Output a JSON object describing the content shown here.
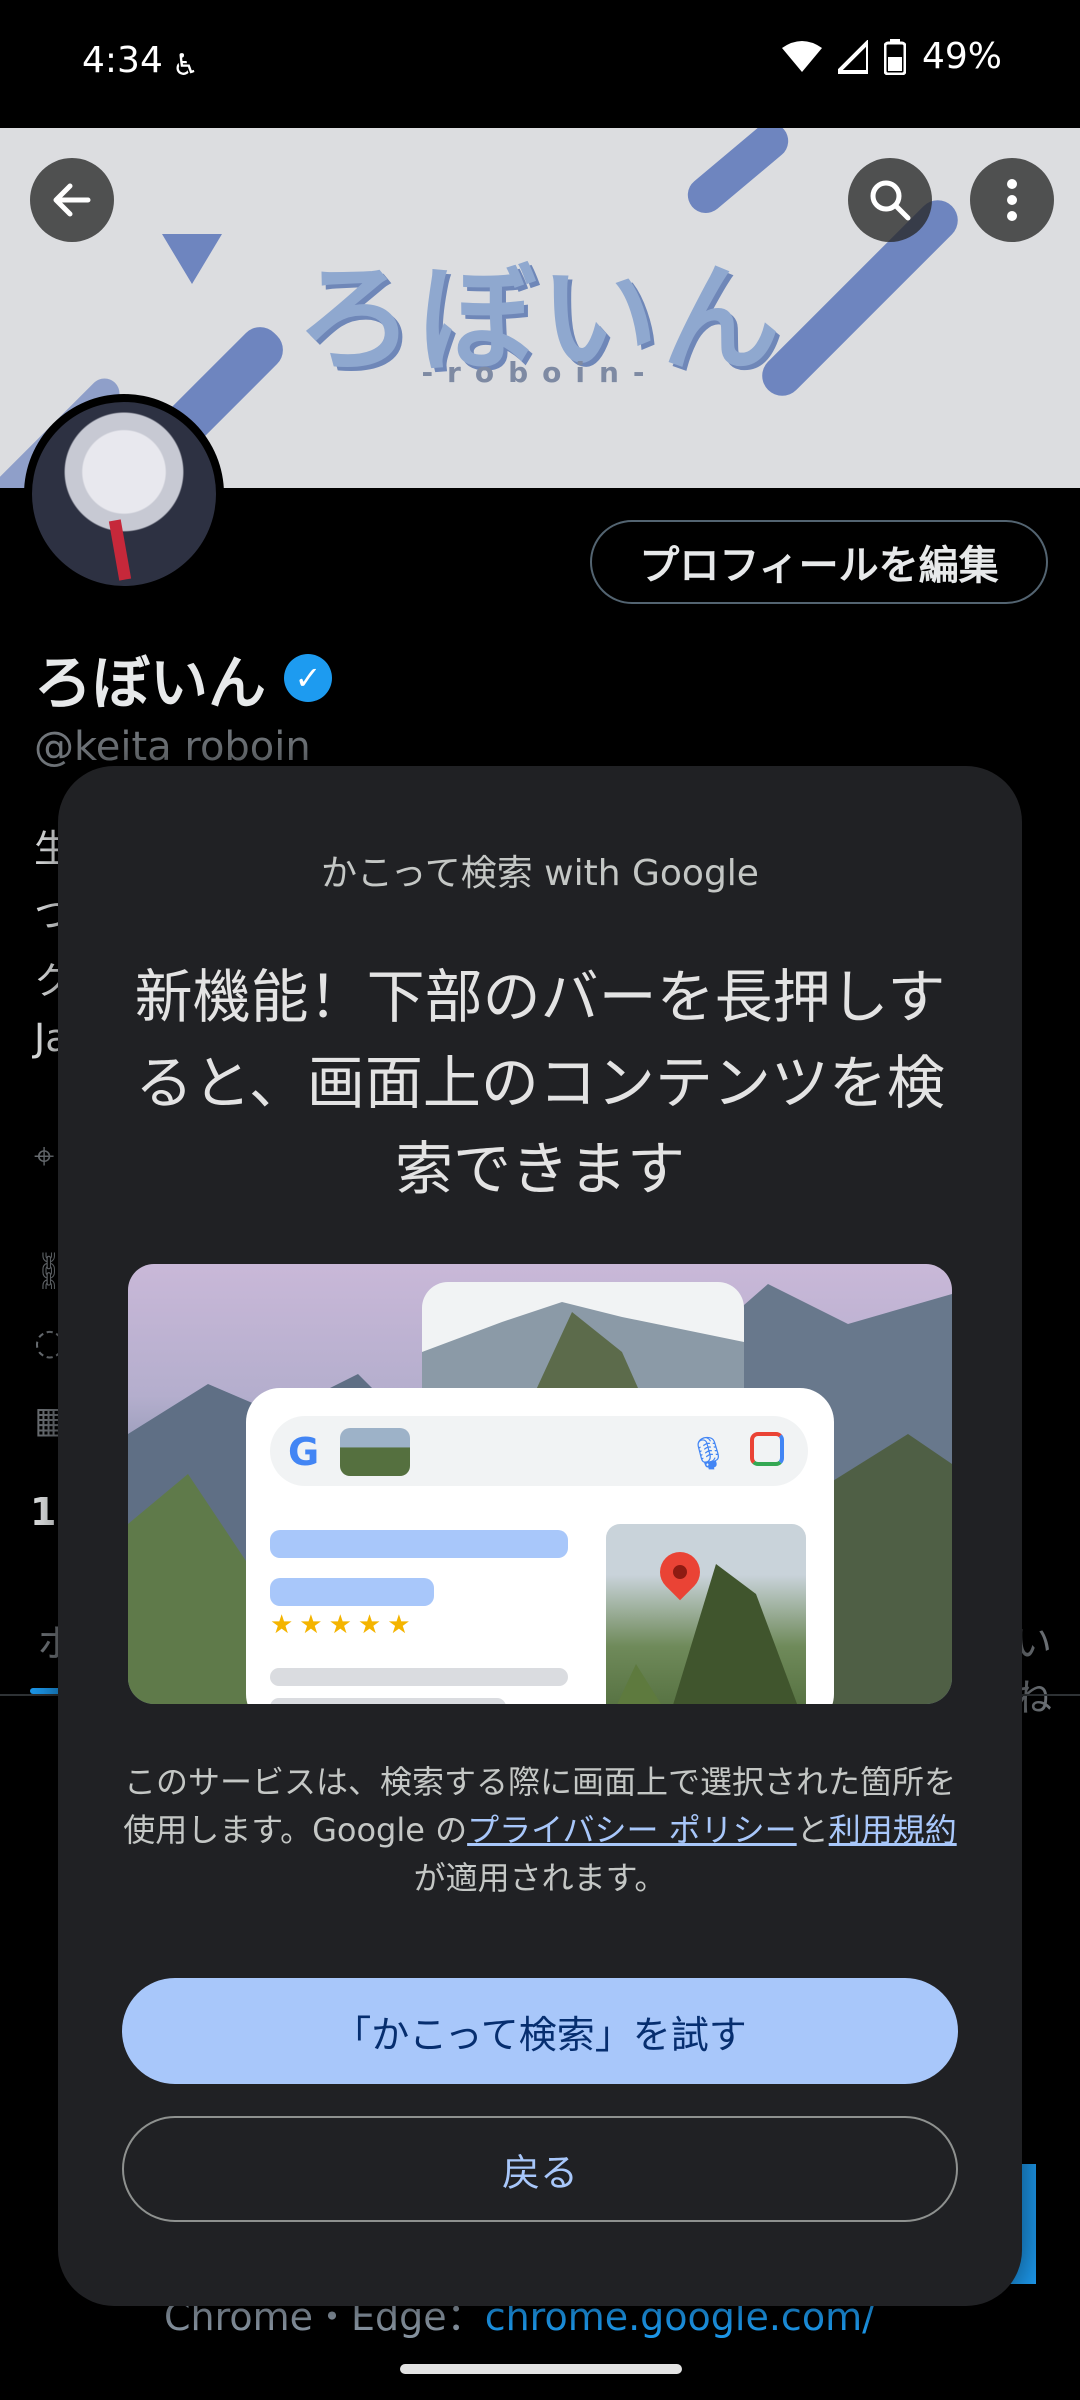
{
  "status_bar": {
    "time": "4:34",
    "battery": "49%"
  },
  "banner": {
    "logo_text": "ろぼいん",
    "logo_sub": "-roboin-"
  },
  "profile": {
    "edit_button": "プロフィールを編集",
    "display_name": "ろぼいん",
    "handle": "@keita roboin",
    "partial_bio_chars": [
      "生",
      "つ",
      "ク",
      "Ja"
    ],
    "partial_stat": "1,",
    "partial_tab_left": "ポ",
    "partial_tab_right": "いね",
    "footer_text_prefix": "Chrome・Edge：",
    "footer_link": "chrome.google.com/"
  },
  "dialog": {
    "subtitle": "かこって検索 with Google",
    "title": "新機能！下部のバーを長押しすると、画面上のコンテンツを検索できます",
    "desc_part1": "このサービスは、検索する際に画面上で選択された箇所を使用します。Google の",
    "privacy_link": "プライバシー ポリシー",
    "desc_part2": "と",
    "terms_link": "利用規約",
    "desc_part3": "が適用されます。",
    "primary_button": "「かこって検索」を試す",
    "secondary_button": "戻る"
  },
  "colors": {
    "dialog_bg": "#202124",
    "primary_button_bg": "#a8c7fa",
    "link_color": "#a8c7fa",
    "twitter_blue": "#1d9bf0"
  },
  "icons": [
    "back-arrow-icon",
    "search-icon",
    "more-vert-icon",
    "verified-badge-icon",
    "wifi-icon",
    "signal-icon",
    "battery-icon"
  ]
}
